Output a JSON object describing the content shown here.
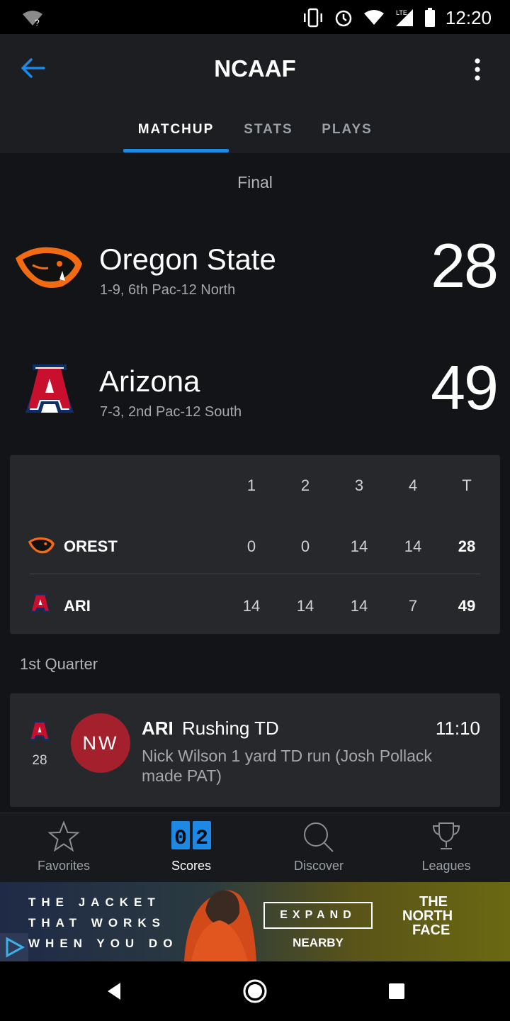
{
  "status_bar": {
    "time": "12:20",
    "network": "LTE"
  },
  "header": {
    "title": "NCAAF",
    "tabs": [
      {
        "label": "MATCHUP",
        "active": true
      },
      {
        "label": "STATS",
        "active": false
      },
      {
        "label": "PLAYS",
        "active": false
      }
    ]
  },
  "game": {
    "status": "Final",
    "away": {
      "name": "Oregon State",
      "record": "1-9, 6th Pac-12 North",
      "score": "28",
      "abbr": "OREST"
    },
    "home": {
      "name": "Arizona",
      "record": "7-3, 2nd Pac-12 South",
      "score": "49",
      "abbr": "ARI"
    }
  },
  "linescore": {
    "headers": [
      "1",
      "2",
      "3",
      "4",
      "T"
    ],
    "rows": [
      {
        "team": "OREST",
        "q": [
          "0",
          "0",
          "14",
          "14"
        ],
        "total": "28"
      },
      {
        "team": "ARI",
        "q": [
          "14",
          "14",
          "14",
          "7"
        ],
        "total": "49"
      }
    ]
  },
  "plays": {
    "section_label": "1st Quarter",
    "items": [
      {
        "team_score": "28",
        "initials": "NW",
        "team": "ARI",
        "type": "Rushing TD",
        "time": "11:10",
        "description": "Nick Wilson 1 yard TD run (Josh Pollack made PAT)"
      }
    ]
  },
  "bottom_nav": [
    {
      "label": "Favorites",
      "icon": "star-icon",
      "active": false
    },
    {
      "label": "Scores",
      "icon": "scoreboard-icon",
      "active": true,
      "icon_text": "02"
    },
    {
      "label": "Discover",
      "icon": "search-icon",
      "active": false
    },
    {
      "label": "Leagues",
      "icon": "trophy-icon",
      "active": false
    }
  ],
  "ad": {
    "line1": "THE JACKET",
    "line2": "THAT WORKS",
    "line3": "WHEN YOU DO",
    "cta": "EXPAND",
    "sub_cta": "NEARBY",
    "brand_line1": "THE",
    "brand_line2": "NORTH",
    "brand_line3": "FACE"
  },
  "colors": {
    "accent": "#1e88e5",
    "avatar": "#a3202c",
    "background": "#121417",
    "card": "#26282b"
  }
}
